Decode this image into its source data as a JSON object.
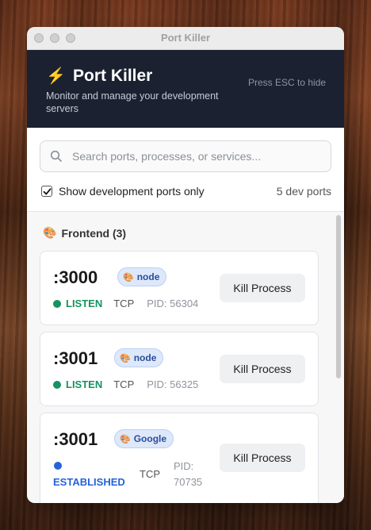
{
  "window": {
    "title": "Port Killer"
  },
  "header": {
    "title": "Port Killer",
    "subtitle": "Monitor and manage your development servers",
    "esc_hint": "Press ESC to hide"
  },
  "search": {
    "placeholder": "Search ports, processes, or services..."
  },
  "filter": {
    "label": "Show development ports only",
    "checked": true,
    "count_text": "5 dev ports"
  },
  "groups": [
    {
      "label": "Frontend (3)"
    }
  ],
  "ports": [
    {
      "port": ":3000",
      "tag": "node",
      "status": "LISTEN",
      "protocol": "TCP",
      "pid": "PID: 56304",
      "action": "Kill Process"
    },
    {
      "port": ":3001",
      "tag": "node",
      "status": "LISTEN",
      "protocol": "TCP",
      "pid": "PID: 56325",
      "action": "Kill Process"
    },
    {
      "port": ":3001",
      "tag": "Google",
      "status": "ESTABLISHED",
      "protocol": "TCP",
      "pid_label": "PID:",
      "pid_value": "70735",
      "action": "Kill Process"
    }
  ],
  "colors": {
    "header_bg": "#1b2130",
    "listen": "#16935f",
    "established": "#2563d9",
    "tag_bg": "#dde8fb"
  }
}
